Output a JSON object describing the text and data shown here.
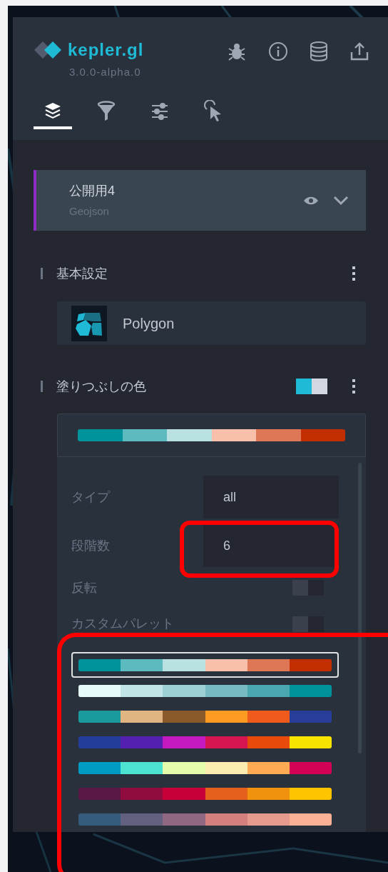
{
  "app": {
    "name": "kepler.gl",
    "version": "3.0.0-alpha.0"
  },
  "tabs": [
    {
      "selected": true
    },
    {
      "selected": false
    },
    {
      "selected": false
    },
    {
      "selected": false
    }
  ],
  "layer": {
    "title": "公開用4",
    "source": "Geojson",
    "color": "#8e2bc5"
  },
  "sections": {
    "basic": "基本設定",
    "fill": "塗りつぶしの色"
  },
  "layer_type": "Polygon",
  "current_palette": [
    {
      "color": "#00939c"
    },
    {
      "color": "#5dbabf"
    },
    {
      "color": "#bae1e2"
    },
    {
      "color": "#f8c0aa"
    },
    {
      "color": "#dd7755"
    },
    {
      "color": "#c22e00"
    }
  ],
  "palette_settings": {
    "rows": [
      {
        "kind": "select",
        "label": "タイプ",
        "value": "all"
      },
      {
        "kind": "select",
        "label": "段階数",
        "value": "6"
      },
      {
        "kind": "toggle",
        "label": "反転",
        "on": false
      },
      {
        "kind": "toggle",
        "label": "カスタムパレット",
        "on": false
      }
    ],
    "palettes": [
      {
        "selected": true,
        "colors": [
          {
            "color": "#00939c"
          },
          {
            "color": "#5dbabf"
          },
          {
            "color": "#bae1e2"
          },
          {
            "color": "#f8c0aa"
          },
          {
            "color": "#dd7755"
          },
          {
            "color": "#c22e00"
          }
        ]
      },
      {
        "selected": false,
        "colors": [
          {
            "color": "#e6fafa"
          },
          {
            "color": "#c1e5e6"
          },
          {
            "color": "#9dd0d4"
          },
          {
            "color": "#75bbc1"
          },
          {
            "color": "#4ba7af"
          },
          {
            "color": "#00939c"
          }
        ]
      },
      {
        "selected": false,
        "colors": [
          {
            "color": "#1a9a9c"
          },
          {
            "color": "#e1b581"
          },
          {
            "color": "#8a5a2c"
          },
          {
            "color": "#fd9a22"
          },
          {
            "color": "#f05a1a"
          },
          {
            "color": "#283d98"
          }
        ]
      },
      {
        "selected": false,
        "colors": [
          {
            "color": "#233d9b"
          },
          {
            "color": "#5320b0"
          },
          {
            "color": "#c31abd"
          },
          {
            "color": "#d4154f"
          },
          {
            "color": "#e84a0c"
          },
          {
            "color": "#f7e400"
          }
        ]
      },
      {
        "selected": false,
        "colors": [
          {
            "color": "#009cc2"
          },
          {
            "color": "#4ce3d0"
          },
          {
            "color": "#e5fcac"
          },
          {
            "color": "#fdecaf"
          },
          {
            "color": "#feab53"
          },
          {
            "color": "#d40255"
          }
        ]
      },
      {
        "selected": false,
        "colors": [
          {
            "color": "#5a1846"
          },
          {
            "color": "#900c3f"
          },
          {
            "color": "#c70039"
          },
          {
            "color": "#e3611c"
          },
          {
            "color": "#f1920e"
          },
          {
            "color": "#ffc300"
          }
        ]
      },
      {
        "selected": false,
        "colors": [
          {
            "color": "#355c7d"
          },
          {
            "color": "#63617f"
          },
          {
            "color": "#916882"
          },
          {
            "color": "#d4807f"
          },
          {
            "color": "#e69a8d"
          },
          {
            "color": "#f8b195"
          }
        ]
      }
    ]
  },
  "annotations": [
    {
      "kind": "highlight"
    },
    {
      "kind": "highlight"
    }
  ]
}
